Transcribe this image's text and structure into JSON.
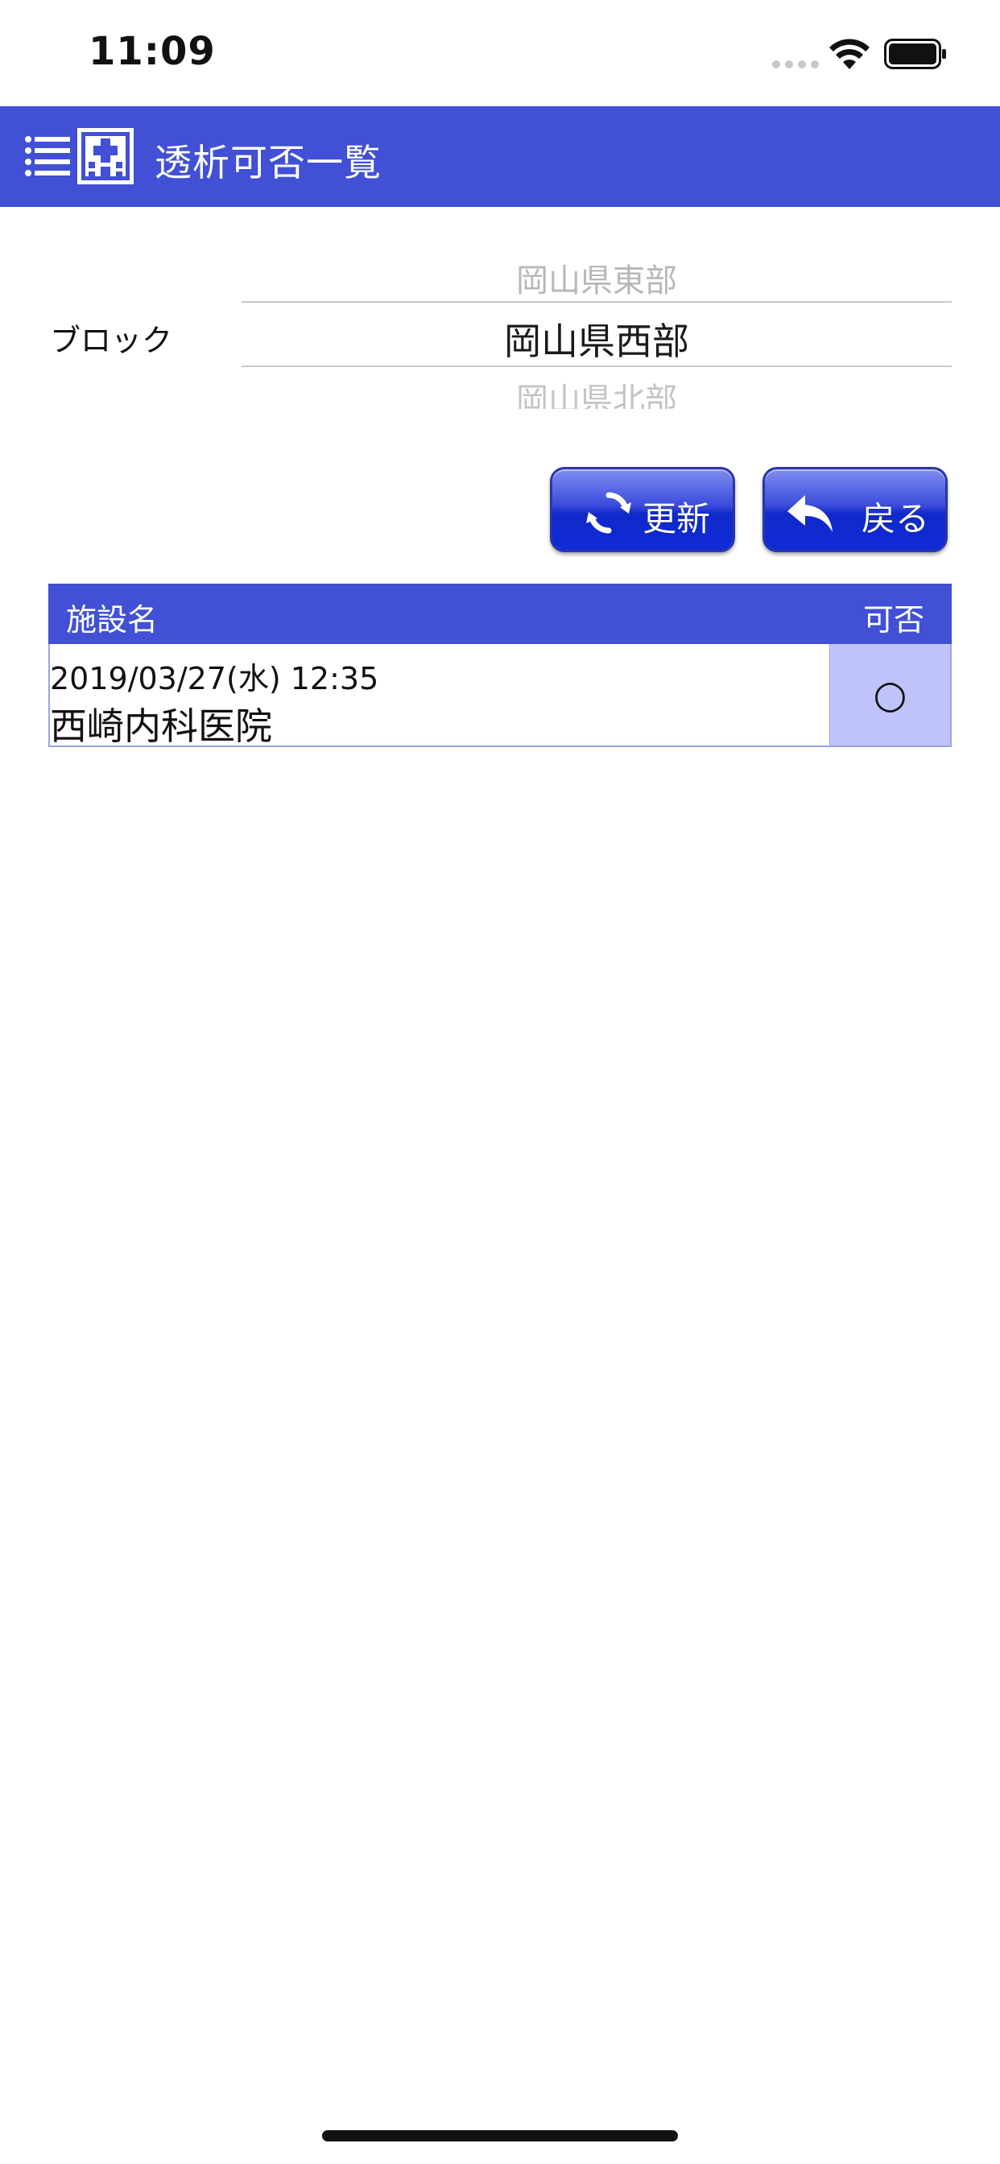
{
  "status_bar": {
    "time": "11:09"
  },
  "nav": {
    "title": "透析可否一覧",
    "color": "#4150d5"
  },
  "picker": {
    "label": "ブロック",
    "prev_option": "岡山県東部",
    "selected_option": "岡山県西部",
    "next_option": "岡山県北部"
  },
  "buttons": {
    "refresh_label": "更新",
    "back_label": "戻る"
  },
  "table": {
    "header_name": "施設名",
    "header_status": "可否",
    "rows": [
      {
        "updated": "2019/03/27(水) 12:35",
        "facility": "西崎内科医院",
        "status": "○"
      }
    ]
  },
  "colors": {
    "accent": "#4150d5",
    "status_cell": "#c0c2fa",
    "button_blue": "#1029c9"
  }
}
